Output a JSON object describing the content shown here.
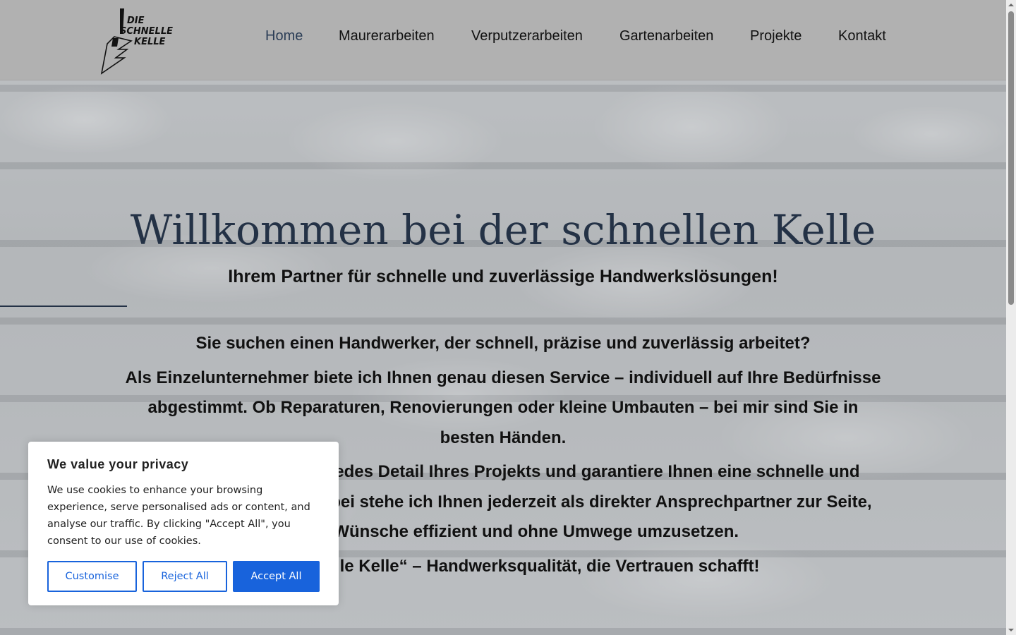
{
  "brand": {
    "logo_lines": [
      "DIE",
      "SCHNELLE",
      "KELLE"
    ],
    "logo_icon": "trowel-icon"
  },
  "nav": {
    "items": [
      {
        "label": "Home",
        "active": true
      },
      {
        "label": "Maurerarbeiten",
        "active": false
      },
      {
        "label": "Verputzerarbeiten",
        "active": false
      },
      {
        "label": "Gartenarbeiten",
        "active": false
      },
      {
        "label": "Projekte",
        "active": false
      },
      {
        "label": "Kontakt",
        "active": false
      }
    ]
  },
  "hero": {
    "title": "Willkommen bei der schnellen Kelle",
    "subtitle": "Ihrem Partner für schnelle und zuverlässige Handwerkslösungen!"
  },
  "content": {
    "paragraphs": [
      "Sie suchen einen Handwerker, der schnell, präzise und zuverlässig arbeitet?",
      "Als Einzelunternehmer biete ich Ihnen genau diesen Service – individuell auf Ihre Bedürfnisse abgestimmt. Ob Reparaturen, Renovierungen oder kleine Umbauten – bei mir sind Sie in besten Händen.",
      "Ich kümmere mich um jedes Detail Ihres Projekts und garantiere Ihnen eine schnelle und saubere Ausführung. Dabei stehe ich Ihnen jederzeit als direkter Ansprechpartner zur Seite, um Ihre Wünsche effizient und ohne Umwege umzusetzen.",
      "„Die schnelle Kelle“ – Handwerksqualität, die Vertrauen schafft!"
    ]
  },
  "cookie_banner": {
    "title": "We value your privacy",
    "text": "We use cookies to enhance your browsing experience, serve personalised ads or content, and analyse our traffic. By clicking \"Accept All\", you consent to our use of cookies.",
    "buttons": {
      "customise": "Customise",
      "reject": "Reject All",
      "accept": "Accept All"
    }
  },
  "colors": {
    "accent": "#1863dc",
    "title": "#243246",
    "nav_active": "#2c3e57",
    "header_bg": "#b1b1b1"
  }
}
